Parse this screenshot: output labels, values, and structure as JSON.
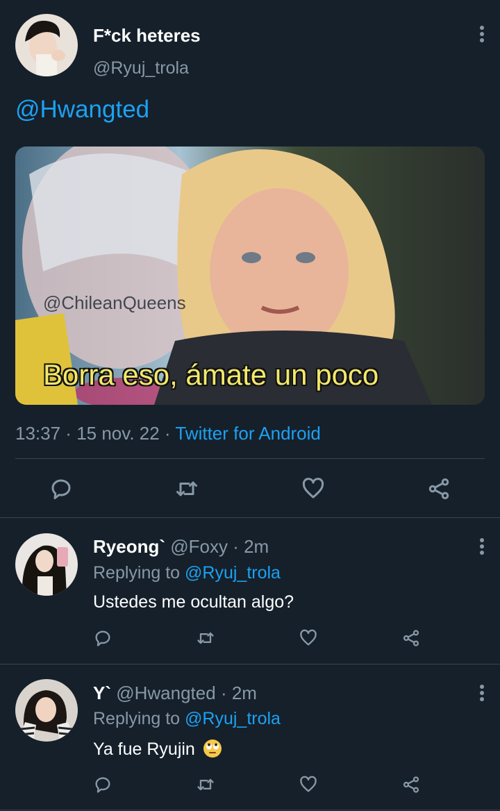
{
  "tweet": {
    "name": "F*ck heteres",
    "handle": "@Ryuj_trola",
    "text_mention": "@Hwangted",
    "media": {
      "watermark": "@ChileanQueens",
      "caption": "Borra eso, ámate un poco"
    },
    "time": "13:37",
    "sep1": " · ",
    "date": "15 nov. 22",
    "sep2": " · ",
    "source": "Twitter for Android"
  },
  "replies": [
    {
      "name": "Ryeong`",
      "handle": "@Foxy",
      "time_sep": " · ",
      "time": "2m",
      "replying_prefix": "Replying to ",
      "replying_to": "@Ryuj_trola",
      "text": "Ustedes me ocultan algo?"
    },
    {
      "name": "Y`",
      "handle": "@Hwangted",
      "time_sep": " · ",
      "time": "2m",
      "replying_prefix": "Replying to ",
      "replying_to": "@Ryuj_trola",
      "text": "Ya fue Ryujin",
      "emoji": "face-with-rolling-eyes"
    }
  ],
  "colors": {
    "background": "#15202b",
    "accent": "#1da1f2",
    "secondary_text": "#8899a6",
    "divider": "#38444d"
  }
}
